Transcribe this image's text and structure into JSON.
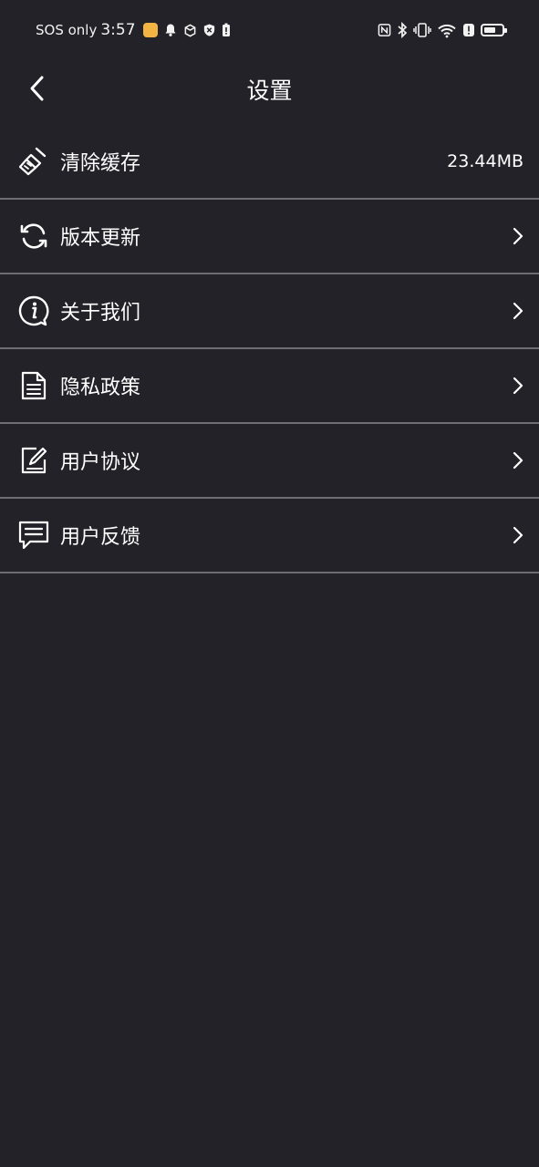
{
  "status_bar": {
    "carrier": "SOS only",
    "time": "3:57"
  },
  "header": {
    "title": "设置"
  },
  "menu": {
    "items": [
      {
        "label": "清除缓存",
        "value": "23.44MB",
        "icon": "broom-icon"
      },
      {
        "label": "版本更新",
        "icon": "refresh-icon"
      },
      {
        "label": "关于我们",
        "icon": "info-bubble-icon"
      },
      {
        "label": "隐私政策",
        "icon": "document-icon"
      },
      {
        "label": "用户协议",
        "icon": "edit-document-icon"
      },
      {
        "label": "用户反馈",
        "icon": "feedback-icon"
      }
    ]
  },
  "colors": {
    "background": "#232228",
    "divider": "#6e6d73",
    "text": "#ffffff"
  }
}
